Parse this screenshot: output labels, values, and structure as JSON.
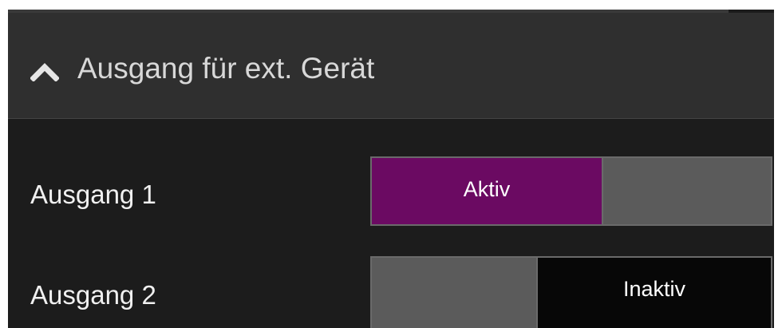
{
  "section": {
    "title": "Ausgang für ext. Gerät",
    "expanded": true,
    "icon": "chevron-up-icon"
  },
  "outputs": [
    {
      "label": "Ausgang 1",
      "state_label": "Aktiv",
      "state": "active",
      "accent": "#6b0a62"
    },
    {
      "label": "Ausgang 2",
      "state_label": "Inaktiv",
      "state": "inactive",
      "accent": "#070707"
    }
  ]
}
